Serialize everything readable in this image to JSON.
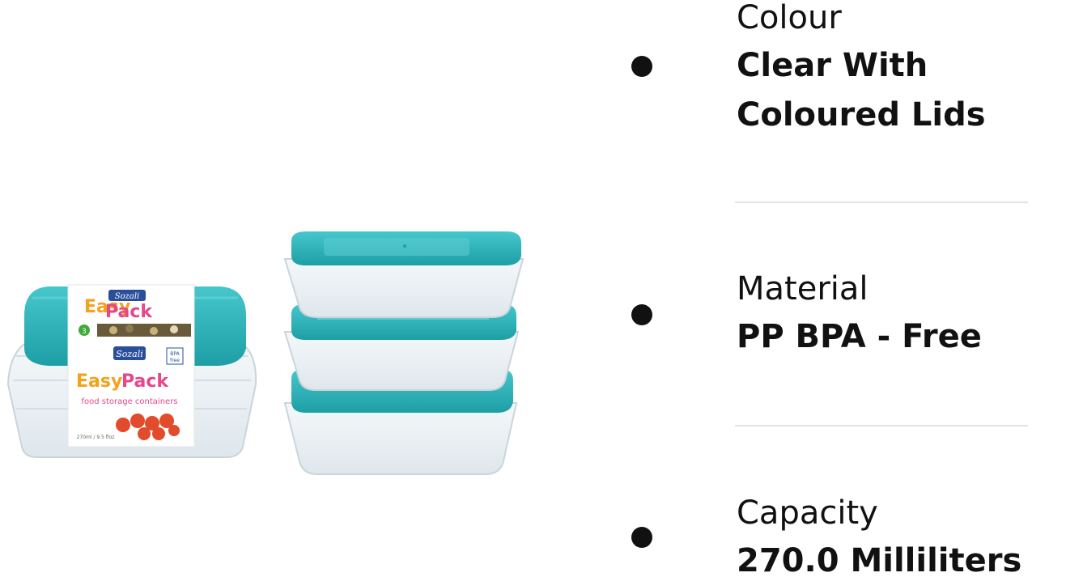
{
  "specs": [
    {
      "label": "Colour",
      "value": "Clear With Coloured Lids"
    },
    {
      "label": "Material",
      "value": "PP BPA - Free"
    },
    {
      "label": "Capacity",
      "value": "270.0 Milliliters"
    }
  ],
  "product_image": {
    "brand": "Sozali",
    "product_name": "EasyPack",
    "pack_title": "Easy Pack",
    "subtitle": "food storage containers",
    "badge": "BPA free",
    "size_text": "270ml / 9.5 floz",
    "count": "3"
  },
  "colors": {
    "lid": "#2fb9bf",
    "lid_dark": "#1d9aa1",
    "container": "#eef3f6",
    "text": "#111111",
    "divider": "#e3e3e3"
  }
}
